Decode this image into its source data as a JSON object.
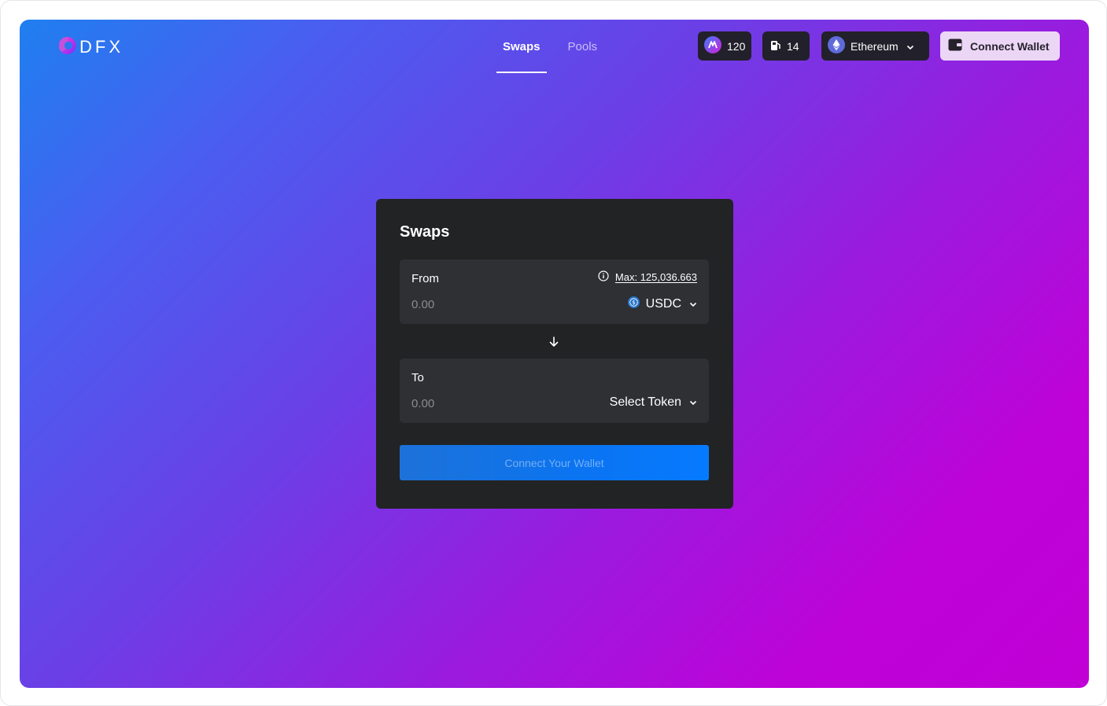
{
  "brand": {
    "name": "DFX"
  },
  "nav": {
    "tabs": [
      {
        "label": "Swaps",
        "active": true
      },
      {
        "label": "Pools",
        "active": false
      }
    ]
  },
  "header": {
    "badge_count": "120",
    "gas_value": "14",
    "network": "Ethereum",
    "connect_label": "Connect Wallet"
  },
  "swap": {
    "title": "Swaps",
    "from": {
      "label": "From",
      "placeholder": "0.00",
      "max_label": "Max: 125,036.663",
      "token": "USDC"
    },
    "to": {
      "label": "To",
      "placeholder": "0.00",
      "token": "Select Token"
    },
    "cta_label": "Connect Your Wallet"
  },
  "icons": {
    "logo": "dfx-logo-icon",
    "badge": "dfx-token-icon",
    "gas": "gas-pump-icon",
    "network": "ethereum-icon",
    "wallet": "wallet-icon",
    "info": "info-icon",
    "usdc": "usdc-icon",
    "chevron": "chevron-down-icon",
    "arrow": "arrow-down-icon"
  },
  "colors": {
    "gradient_start": "#1f7ff0",
    "gradient_end": "#c100d6",
    "card_bg": "#222325",
    "field_bg": "#2e3033",
    "cta_bg": "#067aff",
    "pill_bg": "#22202a",
    "connect_bg": "#ecd6f6"
  }
}
